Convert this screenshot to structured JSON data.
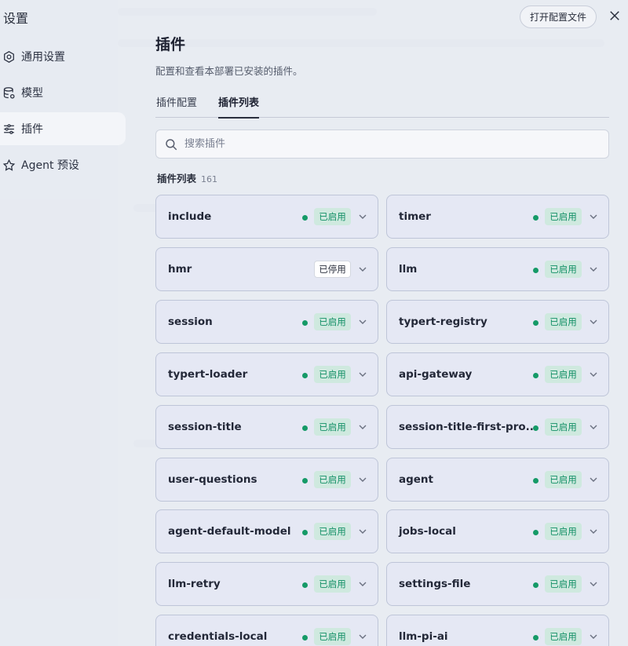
{
  "app": {
    "title": "设置"
  },
  "sidebar": {
    "items": [
      {
        "label": "通用设置",
        "icon": "gear-icon",
        "active": false
      },
      {
        "label": "模型",
        "icon": "database-icon",
        "active": false
      },
      {
        "label": "插件",
        "icon": "sliders-icon",
        "active": true
      },
      {
        "label": "Agent 预设",
        "icon": "robot-icon",
        "active": false
      }
    ]
  },
  "header": {
    "open_config_label": "打开配置文件",
    "close_icon": "close-icon"
  },
  "main": {
    "title": "插件",
    "description": "配置和查看本部署已安装的插件。",
    "tabs": [
      {
        "label": "插件配置",
        "active": false
      },
      {
        "label": "插件列表",
        "active": true
      }
    ],
    "search": {
      "placeholder": "搜索插件",
      "value": ""
    },
    "list_title": "插件列表",
    "list_count": "161"
  },
  "status_labels": {
    "enabled": "已启用",
    "disabled": "已停用"
  },
  "colors": {
    "enabled_dot": "#159a67",
    "enabled_badge_bg": "#cfe9df",
    "enabled_text": "#139066"
  },
  "plugins": [
    {
      "name": "include",
      "status": "已启用",
      "enabled": true
    },
    {
      "name": "timer",
      "status": "已启用",
      "enabled": true
    },
    {
      "name": "hmr",
      "status": "已停用",
      "enabled": false
    },
    {
      "name": "llm",
      "status": "已启用",
      "enabled": true
    },
    {
      "name": "session",
      "status": "已启用",
      "enabled": true
    },
    {
      "name": "typert-registry",
      "status": "已启用",
      "enabled": true
    },
    {
      "name": "typert-loader",
      "status": "已启用",
      "enabled": true
    },
    {
      "name": "api-gateway",
      "status": "已启用",
      "enabled": true
    },
    {
      "name": "session-title",
      "status": "已启用",
      "enabled": true
    },
    {
      "name": "session-title-first-pro...",
      "status": "已启用",
      "enabled": true
    },
    {
      "name": "user-questions",
      "status": "已启用",
      "enabled": true
    },
    {
      "name": "agent",
      "status": "已启用",
      "enabled": true
    },
    {
      "name": "agent-default-model",
      "status": "已启用",
      "enabled": true
    },
    {
      "name": "jobs-local",
      "status": "已启用",
      "enabled": true
    },
    {
      "name": "llm-retry",
      "status": "已启用",
      "enabled": true
    },
    {
      "name": "settings-file",
      "status": "已启用",
      "enabled": true
    },
    {
      "name": "credentials-local",
      "status": "已启用",
      "enabled": true
    },
    {
      "name": "llm-pi-ai",
      "status": "已启用",
      "enabled": true
    }
  ]
}
